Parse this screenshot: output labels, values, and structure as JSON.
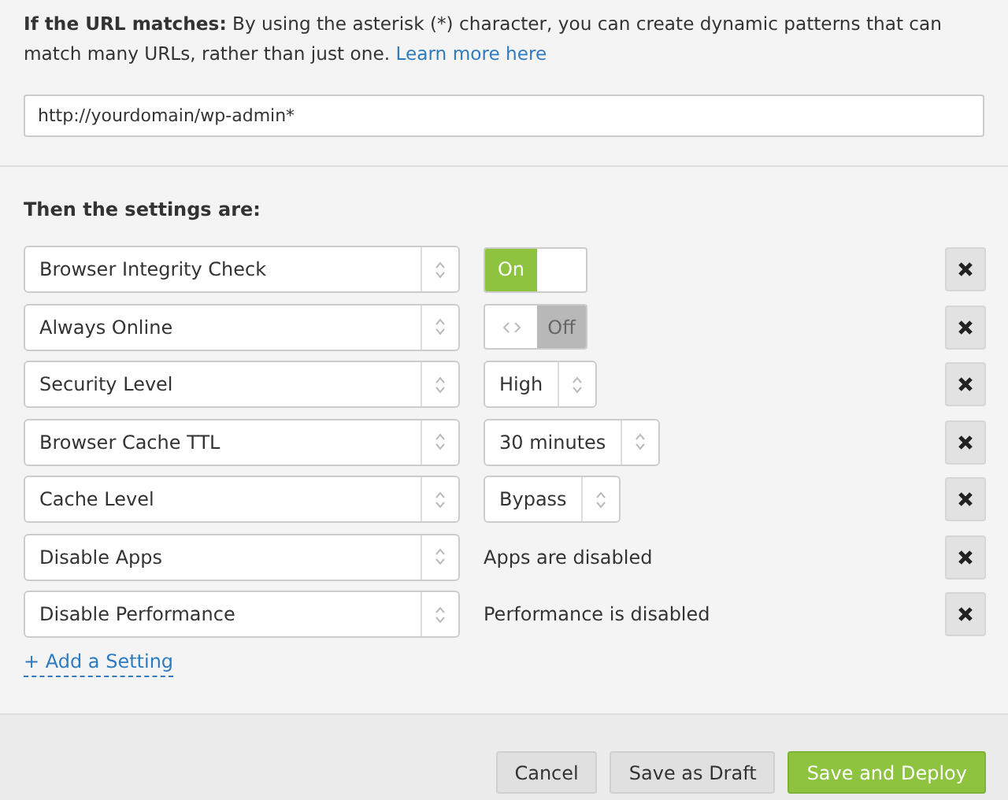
{
  "url_section": {
    "intro": "**If the URL matches:** By using the asterisk (*) character, you can create dynamic patterns that can match many URLs, rather than just one.",
    "learn_more": "Learn more here",
    "url_value": "http://yourdomain/wp-admin*"
  },
  "settings_heading": "Then the settings are:",
  "settings": [
    {
      "name": "Browser Integrity Check",
      "kind": "toggle",
      "on": true,
      "value": "On"
    },
    {
      "name": "Always Online",
      "kind": "toggle",
      "on": false,
      "value": "Off"
    },
    {
      "name": "Security Level",
      "kind": "select",
      "value": "High"
    },
    {
      "name": "Browser Cache TTL",
      "kind": "select",
      "value": "30 minutes"
    },
    {
      "name": "Cache Level",
      "kind": "select",
      "value": "Bypass"
    },
    {
      "name": "Disable Apps",
      "kind": "text",
      "value": "Apps are disabled"
    },
    {
      "name": "Disable Performance",
      "kind": "text",
      "value": "Performance is disabled"
    }
  ],
  "add_setting": "+ Add a Setting",
  "buttons": [
    {
      "label": "Cancel",
      "kind": "secondary"
    },
    {
      "label": "Save as Draft",
      "kind": "secondary"
    },
    {
      "label": "Save and Deploy",
      "kind": "primary"
    }
  ]
}
